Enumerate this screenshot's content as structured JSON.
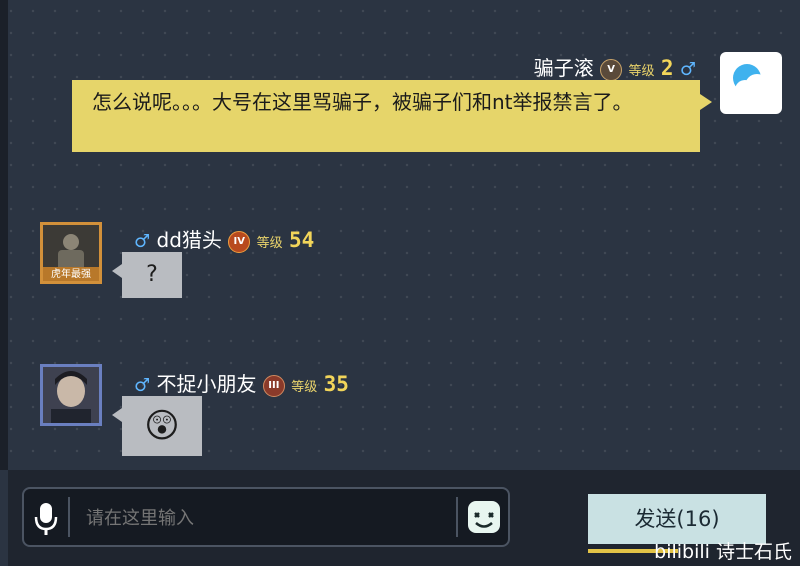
{
  "messages": [
    {
      "side": "right",
      "name": "骗子滚",
      "rank": "V",
      "level_label": "等级",
      "level": "2",
      "gender_symbol": "♂",
      "text": "怎么说呢。。。大号在这里骂骗子，被骗子们和nt举报禁言了。",
      "avatar_icon": "weather-app-icon"
    },
    {
      "side": "left",
      "name": "dd猎头",
      "rank": "IV",
      "level_label": "等级",
      "level": "54",
      "gender_symbol": "♂",
      "text": "?",
      "avatar_icon": "soldier-avatar",
      "avatar_caption": "虎年最强"
    },
    {
      "side": "left",
      "name": "不捉小朋友",
      "rank": "III",
      "level_label": "等级",
      "level": "35",
      "gender_symbol": "♂",
      "emoji": "😲",
      "avatar_icon": "person-photo-avatar"
    }
  ],
  "input": {
    "placeholder": "请在这里输入",
    "mic_icon": "microphone-icon",
    "emoji_icon": "emoji-face-icon"
  },
  "send_button": {
    "label": "发送(16)"
  },
  "watermark": "bilibili 诗士石氏",
  "colors": {
    "background": "#2b3442",
    "self_bubble": "#e6d56a",
    "other_bubble": "#b9bcc1",
    "level_number": "#f2d55a",
    "gender": "#5fb6ff",
    "send_button": "#c9e1e3"
  }
}
